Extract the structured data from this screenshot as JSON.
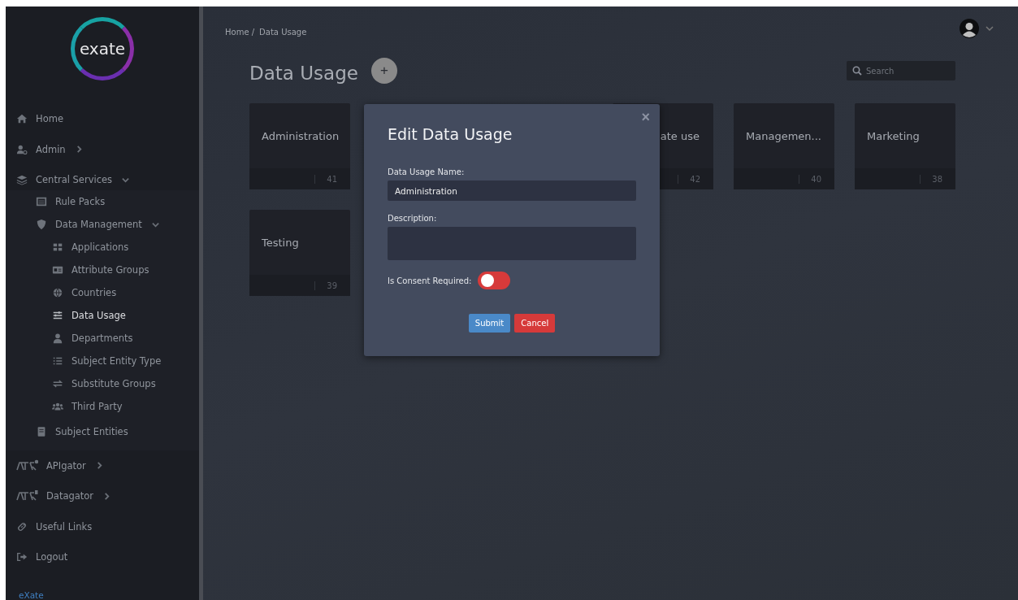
{
  "sidebar": {
    "logo": {
      "text": "exate"
    },
    "items": [
      {
        "label": "Home",
        "selected": false
      },
      {
        "label": "Admin",
        "expanded": false,
        "selected": false
      },
      {
        "label": "Central Services",
        "expanded": true,
        "selected": false,
        "children": [
          {
            "label": "Rule Packs",
            "selected": false
          },
          {
            "label": "Data Management",
            "expanded": true,
            "selected": false,
            "children": [
              {
                "label": "Applications",
                "selected": false
              },
              {
                "label": "Attribute Groups",
                "selected": false
              },
              {
                "label": "Countries",
                "selected": false
              },
              {
                "label": "Data Usage",
                "selected": true
              },
              {
                "label": "Departments",
                "selected": false
              },
              {
                "label": "Subject Entity Type",
                "selected": false
              },
              {
                "label": "Substitute Groups",
                "selected": false
              },
              {
                "label": "Third Party",
                "selected": false
              }
            ]
          },
          {
            "label": "Subject Entities",
            "selected": false
          }
        ]
      },
      {
        "label": "APIgator",
        "expanded": false,
        "selected": false
      },
      {
        "label": "Datagator",
        "expanded": false,
        "selected": false
      },
      {
        "label": "Useful Links",
        "selected": false
      },
      {
        "label": "Logout",
        "selected": false
      }
    ],
    "footer": "eXate"
  },
  "breadcrumb": [
    "Home /",
    "Data Usage"
  ],
  "page_title": "Data Usage",
  "add_button": "+",
  "search": {
    "placeholder": "Search"
  },
  "cards": [
    {
      "title": "Administration",
      "count": "41",
      "kind": "full"
    },
    {
      "title": "ate use",
      "count": "42",
      "kind": "clipped"
    },
    {
      "title": "Managemen...",
      "count": "40",
      "kind": "full"
    },
    {
      "title": "Marketing",
      "count": "38",
      "kind": "full"
    },
    {
      "title": "Testing",
      "count": "39",
      "kind": "full"
    }
  ],
  "modal": {
    "title": "Edit Data Usage",
    "close": "×",
    "name_label": "Data Usage Name:",
    "name_value": "Administration",
    "description_label": "Description:",
    "consent_label": "Is Consent Required:",
    "consent_on": false,
    "buttons": [
      {
        "label": "Submit",
        "kind": "primary"
      },
      {
        "label": "Cancel",
        "kind": "danger"
      }
    ]
  }
}
